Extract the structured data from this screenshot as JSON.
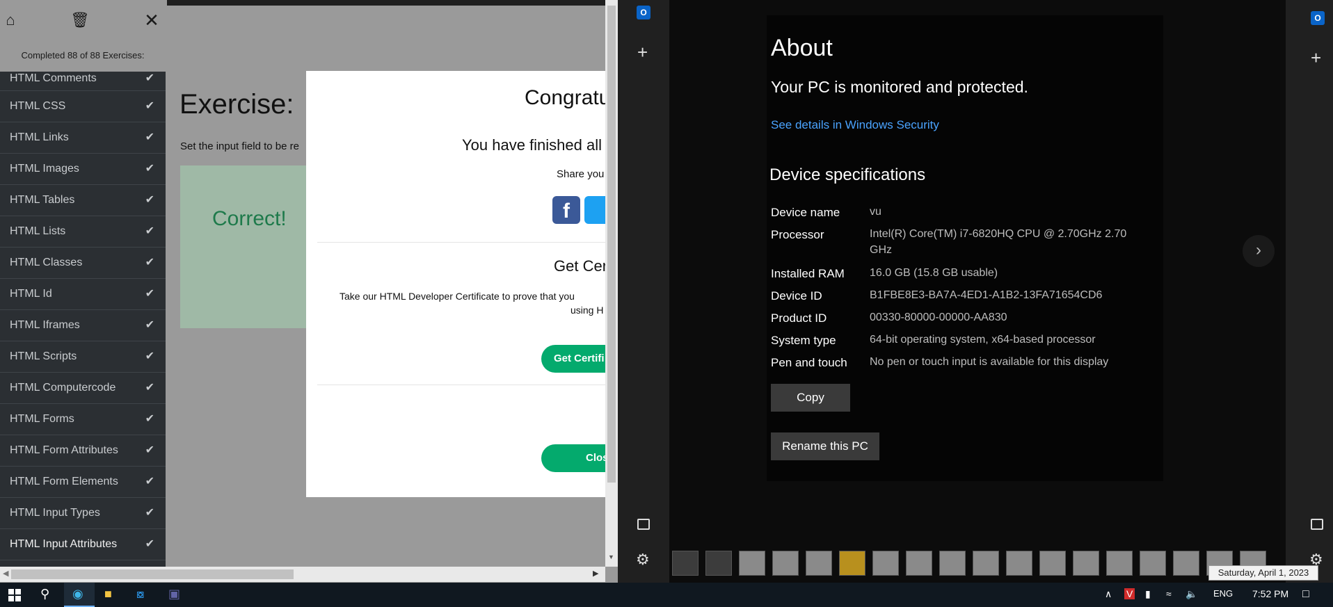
{
  "browser": {
    "completed_text": "Completed 88 of 88 Exercises:",
    "lessons": [
      "HTML Comments",
      "HTML CSS",
      "HTML Links",
      "HTML Images",
      "HTML Tables",
      "HTML Lists",
      "HTML Classes",
      "HTML Id",
      "HTML Iframes",
      "HTML Scripts",
      "HTML Computercode",
      "HTML Forms",
      "HTML Form Attributes",
      "HTML Form Elements",
      "HTML Input Types",
      "HTML Input Attributes"
    ],
    "exercise_title": "Exercise:",
    "exercise_instruction": "Set the input field to be re",
    "correct_text": "Correct!",
    "modal": {
      "title": "Congratu",
      "subtitle": "You have finished all",
      "share": "Share you",
      "cert_title": "Get Cer",
      "cert_text": "Take our HTML Developer Certificate to prove that you",
      "cert_text2": "using H",
      "get_cert_button": "Get Certifi",
      "close_button": "Clos"
    }
  },
  "settings": {
    "title": "About",
    "protected": "Your PC is monitored and protected.",
    "security_link": "See details in Windows Security",
    "device_specs_title": "Device specifications",
    "specs": [
      {
        "label": "Device name",
        "value": "vu"
      },
      {
        "label": "Processor",
        "value": "Intel(R) Core(TM) i7-6820HQ CPU @ 2.70GHz   2.70",
        "value2": "GHz"
      },
      {
        "label": "Installed RAM",
        "value": "16.0 GB (15.8 GB usable)"
      },
      {
        "label": "Device ID",
        "value": "B1FBE8E3-BA7A-4ED1-A1B2-13FA71654CD6"
      },
      {
        "label": "Product ID",
        "value": "00330-80000-00000-AA830"
      },
      {
        "label": "System type",
        "value": "64-bit operating system, x64-based processor"
      },
      {
        "label": "Pen and touch",
        "value": "No pen or touch input is available for this display"
      }
    ],
    "copy_button": "Copy",
    "rename_button": "Rename this PC"
  },
  "date_tooltip": "Saturday, April 1, 2023",
  "taskbar": {
    "language": "ENG",
    "time": "7:52 PM"
  },
  "colors": {
    "accent_green": "#04aa6d",
    "link_blue": "#4aa3ff",
    "sidebar_bg": "#2b2f33"
  }
}
